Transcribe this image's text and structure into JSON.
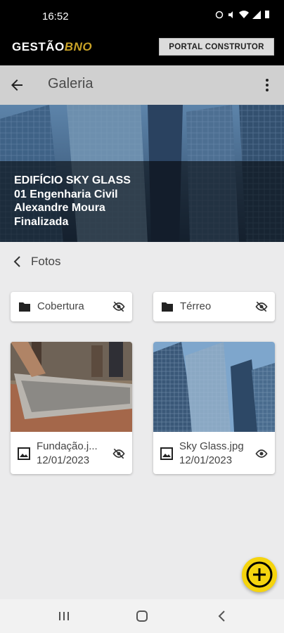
{
  "status_bar": {
    "time": "16:52"
  },
  "brand": {
    "logo_main": "GESTÃO",
    "logo_accent": "BNO",
    "portal_button": "PORTAL CONSTRUTOR"
  },
  "app_bar": {
    "title": "Galeria"
  },
  "hero": {
    "line1": "EDIFÍCIO SKY GLASS",
    "line2": "01 Engenharia Civil",
    "line3": "Alexandre Moura",
    "line4": "Finalizada"
  },
  "section": {
    "label": "Fotos"
  },
  "folders": [
    {
      "name": "Cobertura",
      "visibility": "hidden"
    },
    {
      "name": "Térreo",
      "visibility": "hidden"
    }
  ],
  "photos": [
    {
      "name": "Fundação.j...",
      "date": "12/01/2023",
      "visibility": "hidden"
    },
    {
      "name": "Sky Glass.jpg",
      "date": "12/01/2023",
      "visibility": "visible"
    }
  ],
  "colors": {
    "accent": "#f5d40e",
    "brand_gold": "#c9a227",
    "header": "#000000",
    "app_bar": "#d0d0d0"
  },
  "icons": [
    "back-arrow-icon",
    "more-vert-icon",
    "chevron-left-icon",
    "folder-icon",
    "eye-off-icon",
    "eye-icon",
    "image-icon",
    "add-circle-icon"
  ]
}
